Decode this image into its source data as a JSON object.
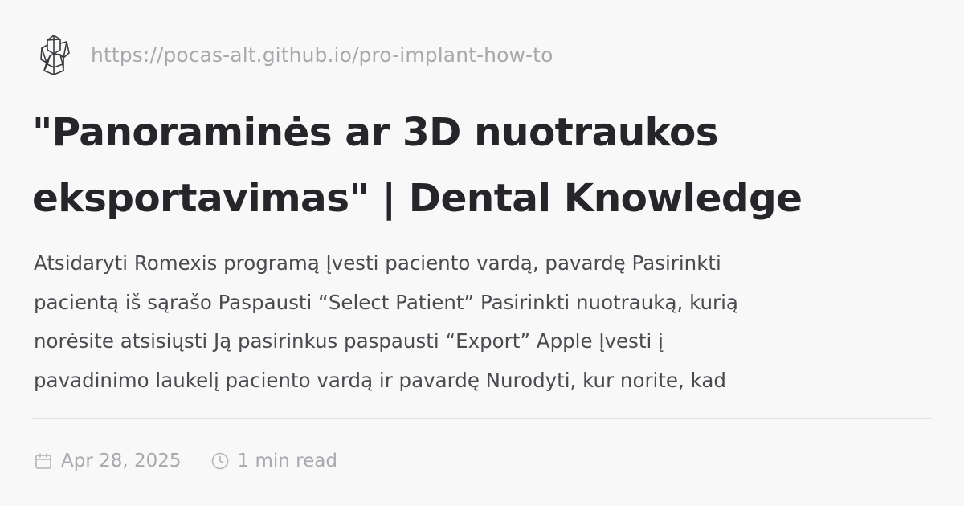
{
  "site": {
    "logo_icon": "crystal-logo-icon",
    "url": "https://pocas-alt.github.io/pro-implant-how-to"
  },
  "article": {
    "title_lines": [
      "\"Panoraminės ar 3D nuotraukos",
      "eksportavimas\" | Dental Knowledge"
    ],
    "description_lines": [
      "Atsidaryti Romexis programą Įvesti paciento vardą, pavardę Pasirinkti",
      "pacientą iš sąrašo Paspausti “Select Patient” Pasirinkti nuotrauką, kurią",
      "norėsite atsisiųsti Ją pasirinkus paspausti “Export” Apple Įvesti į",
      "pavadinimo laukelį paciento vardą ir pavardę Nurodyti, kur norite, kad"
    ]
  },
  "meta": {
    "date_icon": "calendar-icon",
    "date": "Apr 28, 2025",
    "read_icon": "clock-icon",
    "read_time": "1 min read"
  },
  "colors": {
    "background": "#f8f8f9",
    "title": "#26262a",
    "body_text": "#4a4a4f",
    "muted": "#a8a8ad",
    "divider": "#e3e3e6"
  }
}
